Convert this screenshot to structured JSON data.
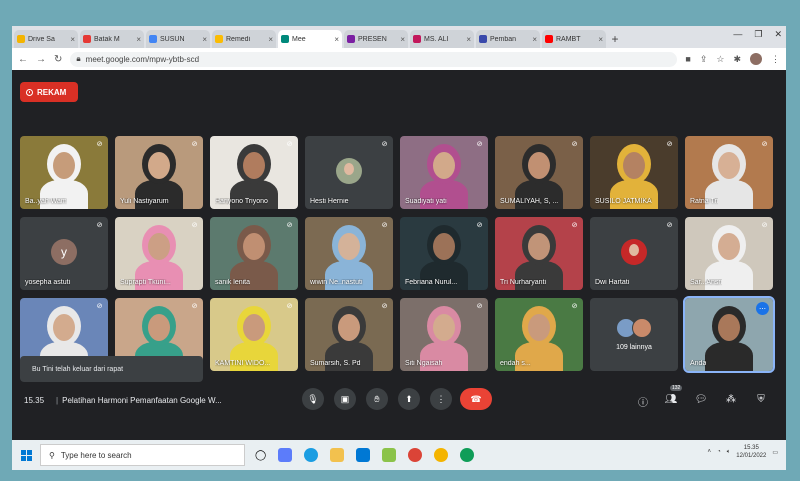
{
  "tabs": [
    {
      "label": "Drive Sa",
      "color": "#f4b400",
      "active": false
    },
    {
      "label": "Batak M",
      "color": "#e53935",
      "active": false
    },
    {
      "label": "SUSUN",
      "color": "#4285f4",
      "active": false
    },
    {
      "label": "Remedi",
      "color": "#fbbc04",
      "active": false
    },
    {
      "label": "Mee",
      "color": "#00897b",
      "active": true
    },
    {
      "label": "PRESEN",
      "color": "#7b1fa2",
      "active": false
    },
    {
      "label": "MS. ALI",
      "color": "#c2185b",
      "active": false
    },
    {
      "label": "Pemban",
      "color": "#3949ab",
      "active": false
    },
    {
      "label": "RAMBT",
      "color": "#ff0000",
      "active": false
    }
  ],
  "url": "meet.google.com/mpw-ybtb-scd",
  "rekam_label": "REKAM",
  "participants": [
    {
      "name": "Ba..yah Wam",
      "bg": "#8a7a3a",
      "skin": "#c69c7a",
      "hijab": "#f2f2f2",
      "type": "video"
    },
    {
      "name": "Yuli Nastiyarum",
      "bg": "#b99a7c",
      "skin": "#d2a98a",
      "hijab": "#2b2b2b",
      "type": "video"
    },
    {
      "name": "Hariyono Triyono",
      "bg": "#e9e6e0",
      "skin": "#b07c5e",
      "hijab": "#3a3a3a",
      "type": "video"
    },
    {
      "name": "Hesti Hernie",
      "bg": "#3c4043",
      "type": "pic",
      "pic": "#9aa68a"
    },
    {
      "name": "Suadiyati yati",
      "bg": "#8e6e84",
      "skin": "#d2a98a",
      "hijab": "#b14f8f",
      "type": "video"
    },
    {
      "name": "SUMALIYAH, S, ...",
      "bg": "#7a6048",
      "skin": "#c19072",
      "hijab": "#2c2c2c",
      "type": "video"
    },
    {
      "name": "SUSILO JATMIKA",
      "bg": "#4a3c2c",
      "skin": "#b48262",
      "hijab": "#e2b23a",
      "type": "video"
    },
    {
      "name": "Ratna Tri",
      "bg": "#b27a4e",
      "skin": "#d7b095",
      "hijab": "#e6e6e6",
      "type": "video"
    },
    {
      "name": "yosepha astuti",
      "bg": "#3c4043",
      "type": "initial",
      "initial": "y",
      "color": "#8d6e63"
    },
    {
      "name": "Suprapti Tkuni...",
      "bg": "#d9d2c3",
      "skin": "#cc9f85",
      "hijab": "#e88fb3",
      "type": "video"
    },
    {
      "name": "sanik lenita",
      "bg": "#5c7a6e",
      "skin": "#c08f72",
      "hijab": "#7a5a4a",
      "type": "video"
    },
    {
      "name": "wiwin Ne..nastuti",
      "bg": "#7c6a52",
      "skin": "#d4b299",
      "hijab": "#8ab4d8",
      "type": "video"
    },
    {
      "name": "Febriana Nurul...",
      "bg": "#2a3a40",
      "skin": "#9c7258",
      "hijab": "#1f2a2e",
      "type": "video"
    },
    {
      "name": "Tri Nurharyanti",
      "bg": "#b4424a",
      "skin": "#c19478",
      "hijab": "#3a3a3a",
      "type": "video"
    },
    {
      "name": "Dwi Hartati",
      "bg": "#3c4043",
      "type": "pic",
      "pic": "#c62828"
    },
    {
      "name": "Sar...Ansri",
      "bg": "#cfc8bc",
      "skin": "#d4ad93",
      "hijab": "#efefef",
      "type": "video"
    },
    {
      "name": "",
      "bg": "#6a86b8",
      "skin": "#d3ab8e",
      "hijab": "#e8e8e8",
      "type": "video"
    },
    {
      "name": "",
      "bg": "#c9a68a",
      "skin": "#c99a7c",
      "hijab": "#37a08a",
      "type": "video"
    },
    {
      "name": "KAMTINI WIDO...",
      "bg": "#d8c98a",
      "skin": "#c99a7c",
      "hijab": "#e8d63a",
      "type": "video"
    },
    {
      "name": "Sumarsih, S. Pd",
      "bg": "#7a6a52",
      "skin": "#c99a7c",
      "hijab": "#3a3a3a",
      "type": "video"
    },
    {
      "name": "Siti Ngaisah",
      "bg": "#7c6f6a",
      "skin": "#d3ab8e",
      "hijab": "#d98aa3",
      "type": "video"
    },
    {
      "name": "endah s...",
      "bg": "#4a7a44",
      "skin": "#c99a7c",
      "hijab": "#e0a84a",
      "type": "video"
    },
    {
      "name": "109 lainnya",
      "bg": "#3c4043",
      "type": "more"
    },
    {
      "name": "Anda",
      "bg": "#8ea6ae",
      "skin": "#a9785a",
      "hijab": "#2a2a2a",
      "type": "self"
    }
  ],
  "toast": "Bu Tini telah keluar dari rapat",
  "meeting": {
    "time": "15.35",
    "title": "Pelatihan Harmoni Pemanfaatan Google W..."
  },
  "people_count": "132",
  "taskbar": {
    "search_placeholder": "Type here to search",
    "time": "15.35",
    "date": "12/01/2022"
  }
}
